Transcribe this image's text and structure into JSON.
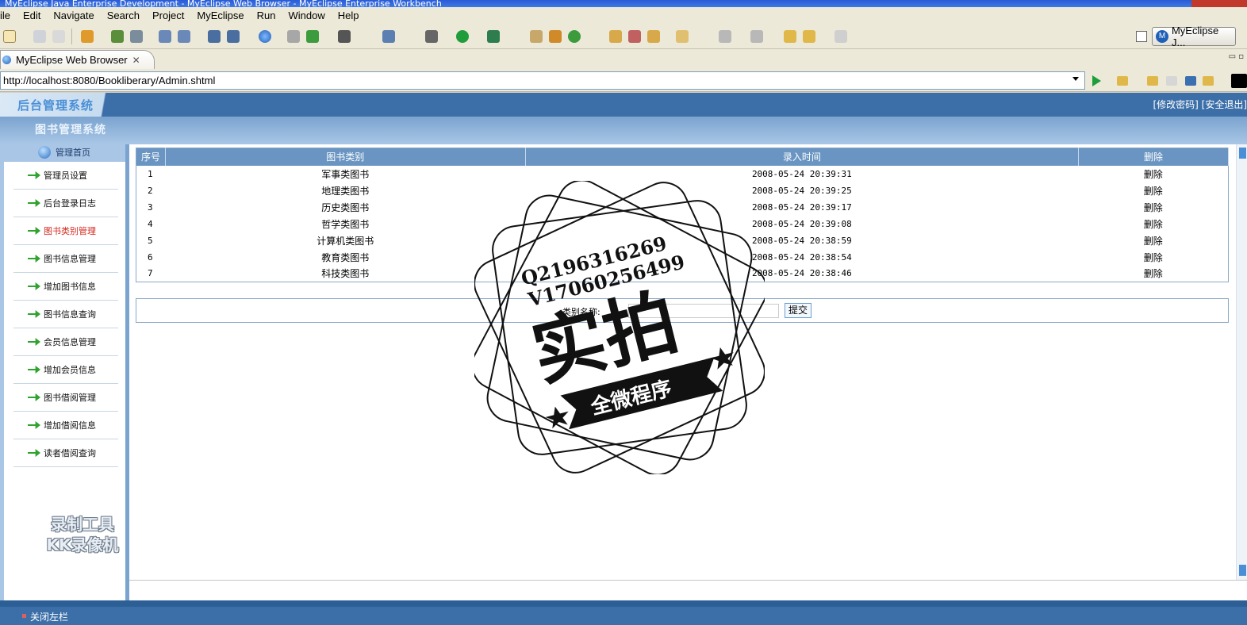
{
  "window": {
    "title": "MyEclipse Java Enterprise Development - MyEclipse Web Browser - MyEclipse Enterprise Workbench"
  },
  "menu": [
    "ile",
    "Edit",
    "Navigate",
    "Search",
    "Project",
    "MyEclipse",
    "Run",
    "Window",
    "Help"
  ],
  "toolbar": {
    "perspective_label": "MyEclipse J..."
  },
  "editor_tab": {
    "label": "MyEclipse Web Browser"
  },
  "browser": {
    "url": "http://localhost:8080/Bookliberary/Admin.shtml"
  },
  "page": {
    "system_title": "后台管理系统",
    "header_links": "[修改密码] [安全退出]",
    "subsystem_title": "图书管理系统",
    "nav_home": "管理首页",
    "nav_items": [
      "管理员设置",
      "后台登录日志",
      "图书类别管理",
      "图书信息管理",
      "增加图书信息",
      "图书信息查询",
      "会员信息管理",
      "增加会员信息",
      "图书借阅管理",
      "增加借阅信息",
      "读者借阅查询"
    ],
    "active_nav_index": 2,
    "table": {
      "columns": [
        "序号",
        "图书类别",
        "录入时间",
        "删除"
      ],
      "rows": [
        {
          "no": "1",
          "category": "军事类图书",
          "time": "2008-05-24 20:39:31",
          "action": "删除"
        },
        {
          "no": "2",
          "category": "地理类图书",
          "time": "2008-05-24 20:39:25",
          "action": "删除"
        },
        {
          "no": "3",
          "category": "历史类图书",
          "time": "2008-05-24 20:39:17",
          "action": "删除"
        },
        {
          "no": "4",
          "category": "哲学类图书",
          "time": "2008-05-24 20:39:08",
          "action": "删除"
        },
        {
          "no": "5",
          "category": "计算机类图书",
          "time": "2008-05-24 20:38:59",
          "action": "删除"
        },
        {
          "no": "6",
          "category": "教育类图书",
          "time": "2008-05-24 20:38:54",
          "action": "删除"
        },
        {
          "no": "7",
          "category": "科技类图书",
          "time": "2008-05-24 20:38:46",
          "action": "删除"
        }
      ]
    },
    "add_form": {
      "label": "类别名称:",
      "submit": "提交"
    },
    "footer_toggle": "关闭左栏"
  },
  "watermarks": {
    "recorder_line1": "录制工具",
    "recorder_line2": "KK录像机",
    "stamp_qq": "Q2196316269",
    "stamp_v": "V17060256499",
    "stamp_main": "实拍",
    "stamp_banner": "全微程序"
  },
  "colors": {
    "header_blue": "#3c6fa8",
    "nav_bg": "#a9c6e6",
    "table_header": "#6a95c2",
    "active_nav": "#d4281d"
  }
}
